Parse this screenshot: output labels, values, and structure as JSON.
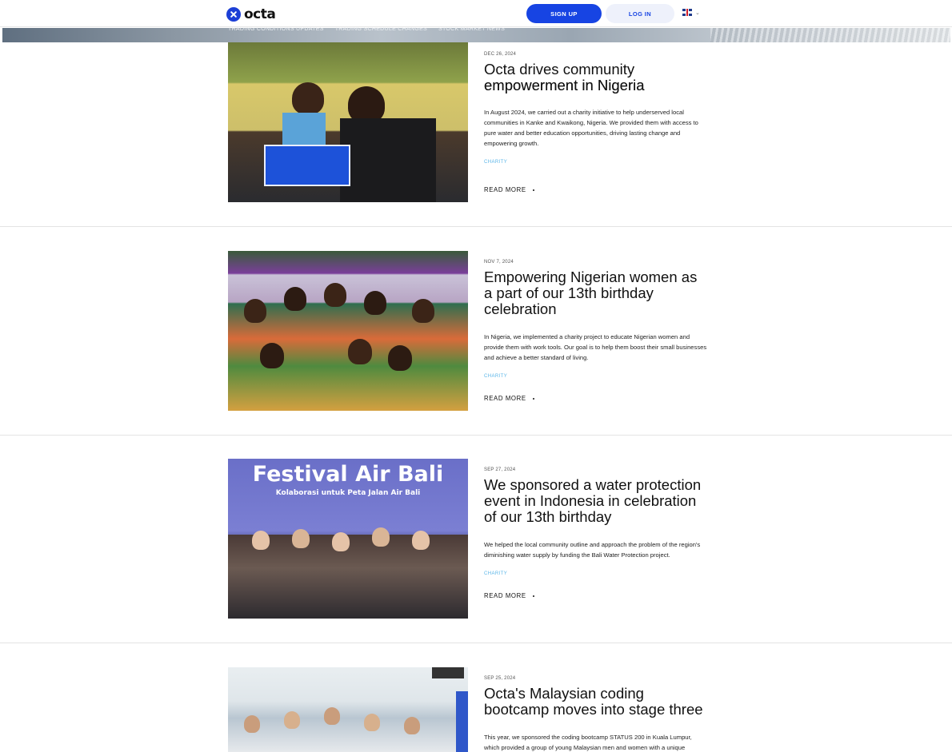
{
  "header": {
    "logo_text": "octa",
    "signup_label": "SIGN UP",
    "login_label": "LOG IN",
    "language_icon": "uk-flag-icon"
  },
  "subnav": [
    "TRADING CONDITIONS UPDATES",
    "TRADING SCHEDULE CHANGES",
    "STOCK MARKET NEWS"
  ],
  "colors": {
    "brand_blue": "#1744e3",
    "tag_blue": "#5bb6e8",
    "login_bg": "#eef1fb"
  },
  "articles": [
    {
      "date": "DEC 26, 2024",
      "title": "Octa drives community empowerment in Nigeria",
      "excerpt": "In August 2024, we carried out a charity initiative to help underserved local communities in Kanke and Kwaikong, Nigeria. We provided them with access to pure water and better education opportunities, driving lasting change and empowering growth.",
      "tag": "CHARITY",
      "read_more": "READ MORE"
    },
    {
      "date": "NOV 7, 2024",
      "title": "Empowering Nigerian women as a part of our 13th birthday celebration",
      "excerpt": "In Nigeria, we implemented a charity project to educate Nigerian women and provide them with work tools. Our goal is to help them boost their small businesses and achieve a better standard of living.",
      "tag": "CHARITY",
      "read_more": "READ MORE"
    },
    {
      "date": "SEP 27, 2024",
      "title": "We sponsored a water protection event in Indonesia in celebration of our 13th birthday",
      "excerpt": "We helped the local community outline and approach the problem of the region's diminishing water supply by funding the Bali Water Protection project.",
      "tag": "CHARITY",
      "read_more": "READ MORE",
      "image_banner_title": "Festival Air Bali",
      "image_banner_subtitle": "Kolaborasi untuk Peta Jalan Air Bali"
    },
    {
      "date": "SEP 25, 2024",
      "title": "Octa's Malaysian coding bootcamp moves into stage three",
      "excerpt": "This year, we sponsored the coding bootcamp STATUS 200 in Kuala Lumpur, which provided a group of young Malaysian men and women with a unique"
    }
  ]
}
